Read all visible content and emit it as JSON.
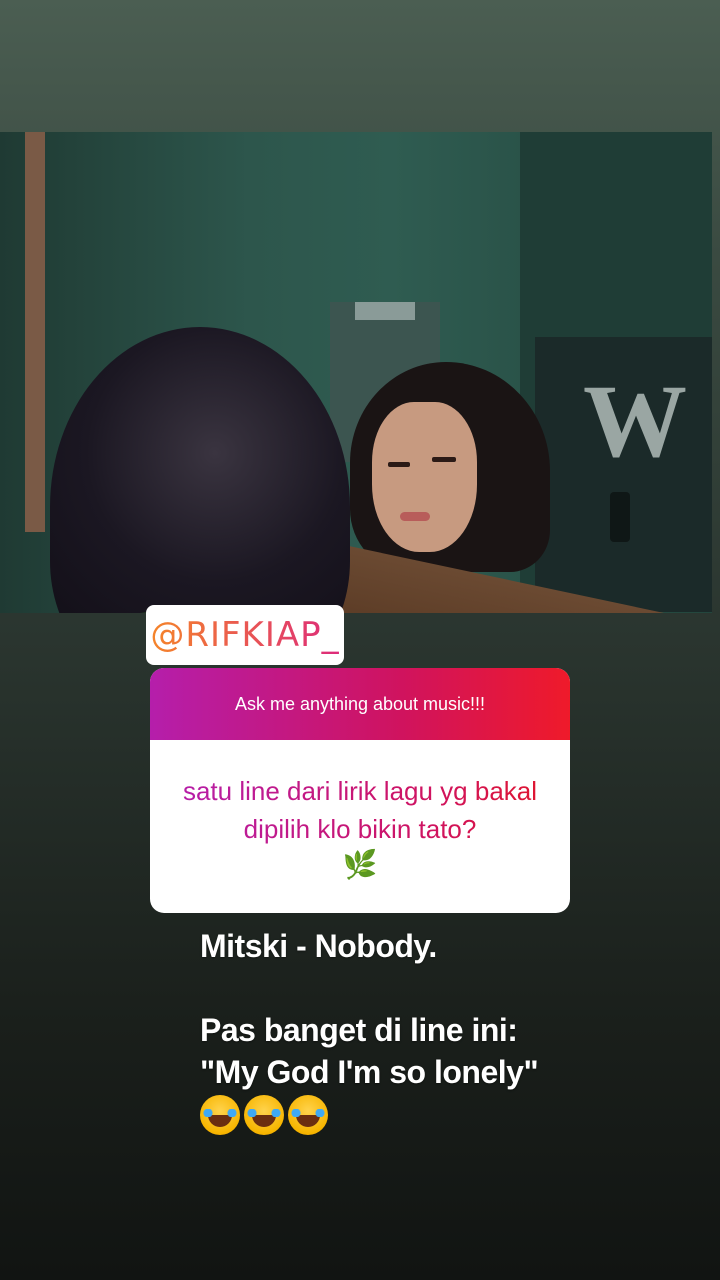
{
  "story": {
    "mention": "@RIFKIAP_",
    "question_box": {
      "header": "Ask me anything about music!!!",
      "question": "satu line dari lirik lagu yg bakal dipilih klo bikin tato?",
      "question_emoji": "🌿"
    },
    "answer": {
      "line1": "Mitski - Nobody.",
      "line2": "Pas banget di line ini:",
      "line3": "\"My God I'm so lonely\"",
      "emojis": [
        "laughing-crying-emoji",
        "laughing-crying-emoji",
        "laughing-crying-emoji"
      ]
    }
  },
  "colors": {
    "gradient_start": "#b51eab",
    "gradient_end": "#ef1a2a",
    "mention_start": "#f58529",
    "mention_end": "#dd2a7b"
  }
}
